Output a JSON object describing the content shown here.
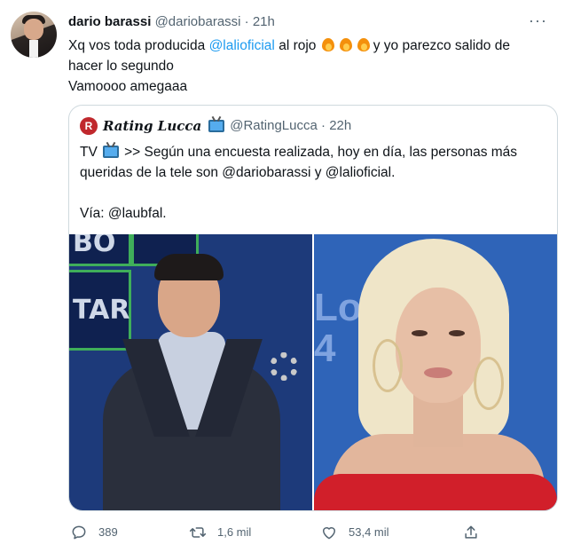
{
  "tweet": {
    "author_name": "dario barassi",
    "author_handle": "@dariobarassi",
    "separator": "·",
    "time": "21h",
    "text_part1": "Xq vos toda producida ",
    "mention": "@lalioficial",
    "text_part2": " al rojo ",
    "text_part3": "y yo parezco salido de hacer lo segundo",
    "text_line2": "Vamoooo amegaaa",
    "more_icon": "more-dots-icon"
  },
  "quote": {
    "logo_letter": "R",
    "account_name": "Rating Lucca",
    "account_handle": "@RatingLucca",
    "separator": "·",
    "time": "22h",
    "line1_part1": "TV ",
    "line1_part2": ">> Según una encuesta realizada, hoy en día, las personas más",
    "line2": "queridas de la tele son @dariobarassi y @lalioficial.",
    "line4": "Vía: @laubfal."
  },
  "media": {
    "left_panel_text_1": "BO",
    "left_panel_text_2": "TAR",
    "right_bg_text": "Los 4"
  },
  "actions": {
    "reply_count": "389",
    "retweet_count": "1,6 mil",
    "like_count": "53,4 mil"
  },
  "colors": {
    "accent": "#1d9bf0",
    "secondary_text": "#536471",
    "border": "#cfd9de",
    "rating_logo": "#c0282d"
  }
}
